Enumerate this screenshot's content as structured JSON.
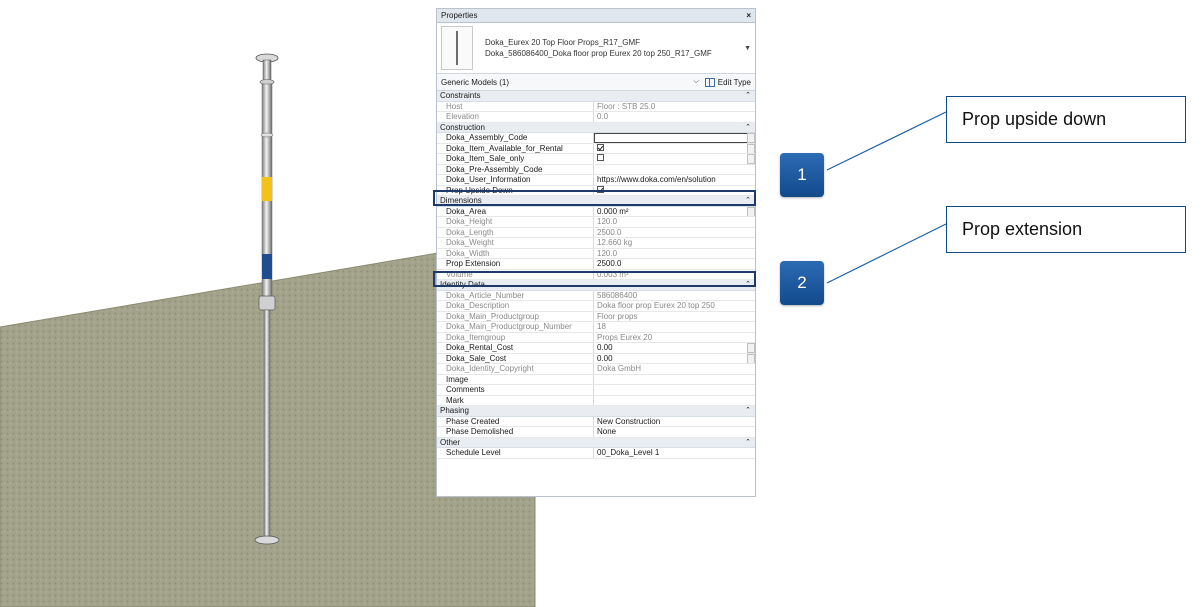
{
  "panel": {
    "title": "Properties",
    "close_glyph": "×",
    "family_name": "Doka_Eurex 20 Top Floor Props_R17_GMF",
    "type_name": "Doka_586086400_Doka floor prop Eurex 20 top 250_R17_GMF",
    "category_filter": "Generic Models (1)",
    "edit_type_label": "Edit Type"
  },
  "groups": {
    "constraints": "Constraints",
    "construction": "Construction",
    "dimensions": "Dimensions",
    "identity": "Identity Data",
    "phasing": "Phasing",
    "other": "Other"
  },
  "rows": {
    "constraints": [
      {
        "k": "Host",
        "v": "Floor : STB 25.0"
      },
      {
        "k": "Elevation",
        "v": "0.0"
      }
    ],
    "construction": [
      {
        "k": "Doka_Assembly_Code",
        "v": ""
      },
      {
        "k": "Doka_Item_Available_for_Rental",
        "v": ""
      },
      {
        "k": "Doka_Item_Sale_only",
        "v": ""
      },
      {
        "k": "Doka_Pre-Assembly_Code",
        "v": ""
      },
      {
        "k": "Doka_User_Information",
        "v": "https://www.doka.com/en/solution"
      },
      {
        "k": "Prop Upside Down",
        "v": ""
      }
    ],
    "dimensions": [
      {
        "k": "Doka_Area",
        "v": "0.000 m²"
      },
      {
        "k": "Doka_Height",
        "v": "120.0"
      },
      {
        "k": "Doka_Length",
        "v": "2500.0"
      },
      {
        "k": "Doka_Weight",
        "v": "12.660 kg"
      },
      {
        "k": "Doka_Width",
        "v": "120.0"
      },
      {
        "k": "Prop Extension",
        "v": "2500.0"
      },
      {
        "k": "Volume",
        "v": "0.003 m³"
      }
    ],
    "identity": [
      {
        "k": "Doka_Article_Number",
        "v": "586086400"
      },
      {
        "k": "Doka_Description",
        "v": "Doka floor prop Eurex 20 top 250"
      },
      {
        "k": "Doka_Main_Productgroup",
        "v": "Floor props"
      },
      {
        "k": "Doka_Main_Productgroup_Number",
        "v": "18"
      },
      {
        "k": "Doka_Itemgroup",
        "v": "Props Eurex 20"
      },
      {
        "k": "Doka_Rental_Cost",
        "v": "0.00"
      },
      {
        "k": "Doka_Sale_Cost",
        "v": "0.00"
      },
      {
        "k": "Doka_Identity_Copyright",
        "v": "Doka GmbH"
      },
      {
        "k": "Image",
        "v": ""
      },
      {
        "k": "Comments",
        "v": ""
      },
      {
        "k": "Mark",
        "v": ""
      }
    ],
    "phasing": [
      {
        "k": "Phase Created",
        "v": "New Construction"
      },
      {
        "k": "Phase Demolished",
        "v": "None"
      }
    ],
    "other": [
      {
        "k": "Schedule Level",
        "v": "00_Doka_Level 1"
      }
    ]
  },
  "checkboxes": {
    "rental": true,
    "sale_only": false,
    "upside_down": true
  },
  "callouts": {
    "one": {
      "number": "1",
      "text": "Prop upside down"
    },
    "two": {
      "number": "2",
      "text": "Prop extension"
    }
  },
  "colors": {
    "accent": "#1e3a6b",
    "badge": "#124a8c",
    "prop_yellow": "#f2c21a",
    "prop_blue": "#1f4d8f",
    "floor": "#9a9a82"
  }
}
